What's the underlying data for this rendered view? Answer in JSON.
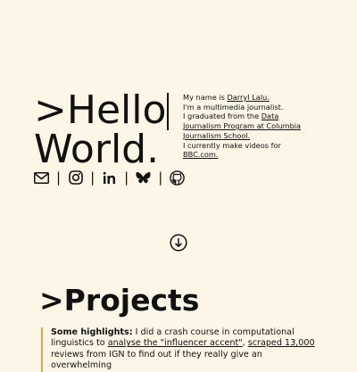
{
  "hero": {
    "title_line1": ">Hello",
    "title_line2": "World."
  },
  "bio": {
    "line1_prefix": "My name is ",
    "name_link": "Darryl Lalu.",
    "line2": "I'm a multimedia journalist.",
    "line3_prefix": "I graduated from the ",
    "program_link": "Data Journalism Program at Columbia Journalism School.",
    "line4_prefix": "I currently make videos for ",
    "bbc_link": "BBC.com."
  },
  "socials": {
    "separator": "|",
    "items": [
      "email-icon",
      "instagram-icon",
      "linkedin-icon",
      "bluesky-icon",
      "github-icon"
    ]
  },
  "scroll": {
    "icon": "arrow-down-circle-icon"
  },
  "projects": {
    "title": ">Projects",
    "highlights_label": "Some highlights:",
    "text1": " I did a crash course in computational linguistics to ",
    "link1": "analyse the \"influencer accent\"",
    "text2": ", ",
    "link2": "scraped 13,000",
    "text3": " reviews from IGN to find out if they really give an overwhelming"
  },
  "colors": {
    "background": "#fdf5e6",
    "text": "#111111",
    "accent": "#e0a64a"
  }
}
